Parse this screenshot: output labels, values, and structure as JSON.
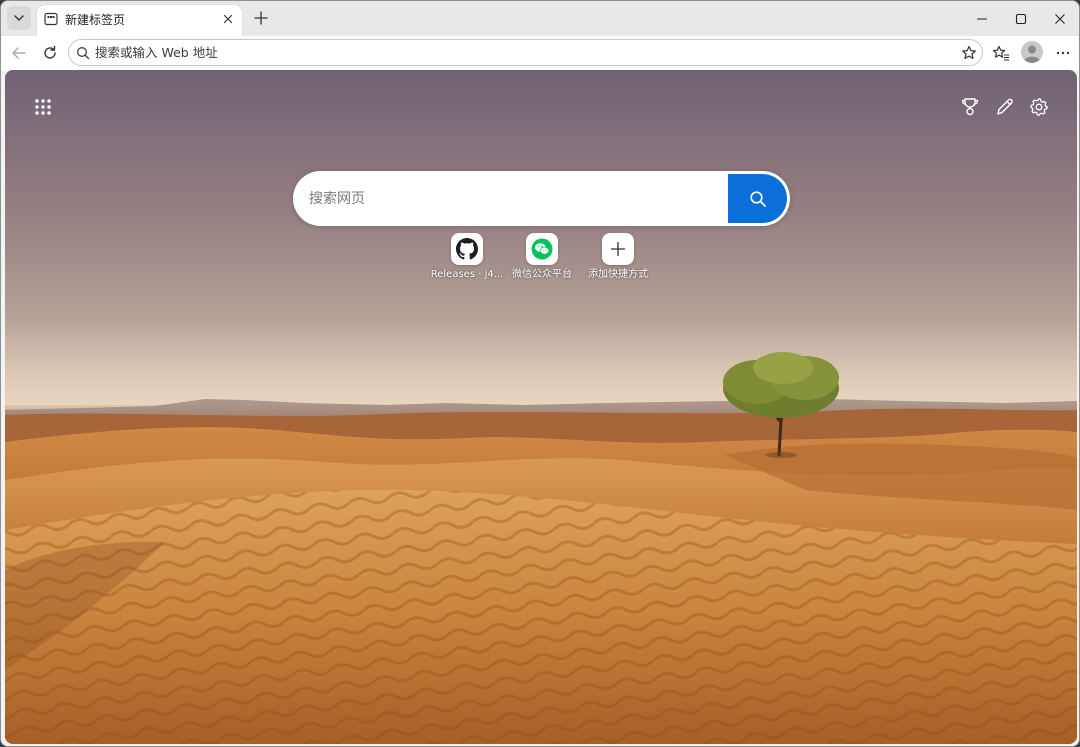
{
  "tab": {
    "title": "新建标签页"
  },
  "toolbar": {
    "address_placeholder": "搜索或输入 Web 地址"
  },
  "ntp": {
    "search_placeholder": "搜索网页",
    "quick_links": [
      {
        "label": "Releases · j4...",
        "icon": "github-icon"
      },
      {
        "label": "微信公众平台",
        "icon": "wechat-icon"
      },
      {
        "label": "添加快捷方式",
        "icon": "plus-icon"
      }
    ]
  },
  "colors": {
    "accent": "#0a6fd9",
    "wechat_green": "#07c160"
  }
}
